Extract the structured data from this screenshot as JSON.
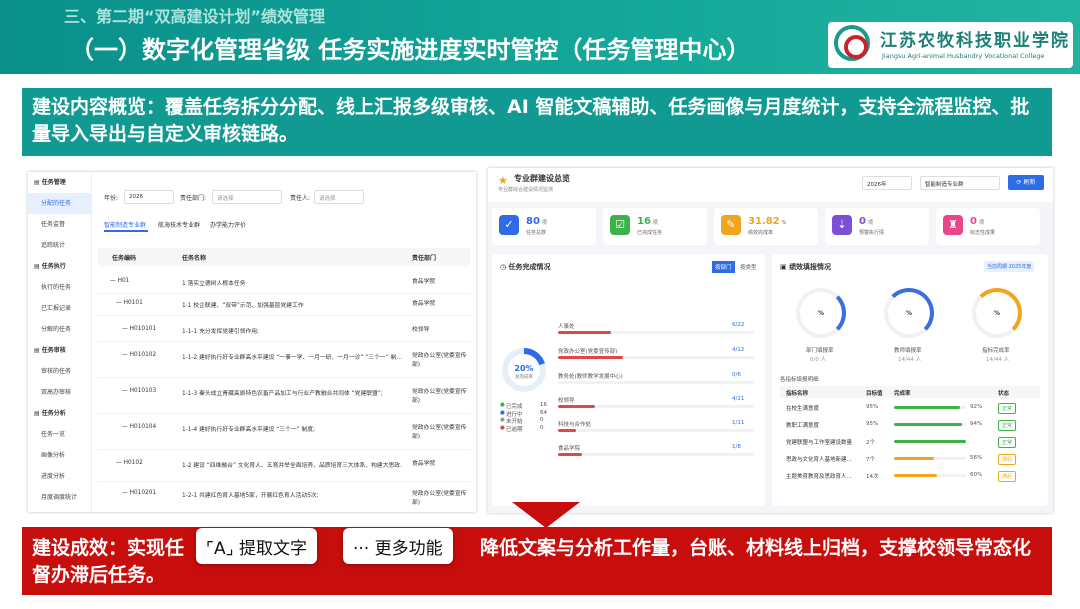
{
  "header": {
    "section": "三、第二期“双高建设计划”绩效管理",
    "title": "（一）数字化管理省级 任务实施进度实时管控（任务管理中心）",
    "school_cn": "江苏农牧科技职业学院",
    "school_en": "Jiangsu Agri-animal Husbandry Vocational College"
  },
  "overview": {
    "label": "建设内容概览：",
    "text": "覆盖任务拆分分配、线上汇报多级审核、AI 智能文稿辅助、任务画像与月度统计，支持全流程监控、批量导入导出与自定义审核链路。"
  },
  "outcome": {
    "label": "建设成效：",
    "text_a": "实现任",
    "text_b": "降低文案与分析工作量，台账、材料线上归档，支撑校领导常态化督办滞后任务。"
  },
  "popup": {
    "extract": "提取文字",
    "more": "更多功能"
  },
  "left": {
    "sidebar": [
      {
        "g": "任务管理",
        "items": [
          "分配的任务",
          "任务监督",
          "追踪统计"
        ]
      },
      {
        "g": "任务执行",
        "items": [
          "执行的任务",
          "已汇报记录",
          "分解的任务"
        ]
      },
      {
        "g": "任务审核",
        "items": [
          "审核的任务",
          "双高办审核"
        ]
      },
      {
        "g": "任务分析",
        "items": [
          "任务一览",
          "画像分析",
          "进度分析",
          "月度调度统计"
        ]
      }
    ],
    "filters": {
      "year_label": "年份:",
      "year": "2026",
      "dept_label": "责任部门:",
      "dept_ph": "请选择",
      "person_label": "责任人:",
      "person_ph": "请选择"
    },
    "tabs": [
      "智能制造专业群",
      "航海技术专业群",
      "办学能力评价"
    ],
    "cols": [
      "任务编码",
      "任务名称",
      "责任部门"
    ],
    "rows": [
      {
        "code": "— H01",
        "name": "1 落实立德树人根本任务",
        "dept": "食品学院",
        "lvl": 0
      },
      {
        "code": "— H0101",
        "name": "1-1 校企联建、“双带”示范、加强基层党建工作",
        "dept": "食品学院",
        "lvl": 1
      },
      {
        "code": "— H010101",
        "name": "1-1-1 充分发挥党建引领作用;",
        "dept": "校领导",
        "lvl": 2
      },
      {
        "code": "— H010102",
        "name": "1-1-2 建好执行好专业群高水平建设 “一事一学、一月一研、一月一诊” “三个一” 制…",
        "dept": "党政办公室(党委宣传部)",
        "lvl": 2
      },
      {
        "code": "— H010103",
        "name": "1-1-3 秦头成立青藏高原特色农畜产品加工与行业产教融合共同体 “党建联盟”;",
        "dept": "党政办公室(党委宣传部)",
        "lvl": 2
      },
      {
        "code": "— H010104",
        "name": "1-1-4 建好执行好专业群高水平建设 “三个一” 制度;",
        "dept": "党政办公室(党委宣传部)",
        "lvl": 2
      },
      {
        "code": "— H0102",
        "name": "1-2 建设 “四维融合” 文化育人、五育并举全面培养、品质培育三大体系、构建大思政…",
        "dept": "食品学院",
        "lvl": 1
      },
      {
        "code": "— H010201",
        "name": "1-2-1 共建红色育人基地5家，开展红色育人活动5次;",
        "dept": "党政办公室(党委宣传部)",
        "lvl": 2
      }
    ]
  },
  "right": {
    "title": "专业群建设总览",
    "subtitle": "专业群综合建设情况监测",
    "year": "2026年",
    "group": "智能制造专业群",
    "refresh": "刷新",
    "cards": [
      {
        "v": "80",
        "u": "项",
        "l": "任务总数",
        "c": "#2e6be6"
      },
      {
        "v": "16",
        "u": "项",
        "l": "已完成任务",
        "c": "#3cb34a"
      },
      {
        "v": "31.82",
        "u": "%",
        "l": "绩效完成率",
        "c": "#f2a51c"
      },
      {
        "v": "0",
        "u": "项",
        "l": "预警执行情",
        "c": "#7b4fd6"
      },
      {
        "v": "0",
        "u": "项",
        "l": "标志性成果",
        "c": "#e8488a"
      }
    ],
    "task": {
      "title": "任务完成情况",
      "btn_a": "按部门",
      "btn_b": "按类型",
      "pct": "20%",
      "pct_label": "总完成率",
      "legend": [
        {
          "l": "已完成",
          "v": "16",
          "c": "#3cb34a"
        },
        {
          "l": "进行中",
          "v": "64",
          "c": "#2e6be6"
        },
        {
          "l": "未开始",
          "v": "0",
          "c": "#999"
        },
        {
          "l": "已逾期",
          "v": "0",
          "c": "#e04848"
        }
      ],
      "depts": [
        {
          "n": "人事处",
          "v": "6/22",
          "p": 0.27
        },
        {
          "n": "党政办公室(党委宣传部)",
          "v": "4/12",
          "p": 0.33
        },
        {
          "n": "教务处(教师教学发展中心)",
          "v": "0/6",
          "p": 0.0
        },
        {
          "n": "校领导",
          "v": "4/21",
          "p": 0.19
        },
        {
          "n": "科技与合作处",
          "v": "1/11",
          "p": 0.09
        },
        {
          "n": "食品学院",
          "v": "1/8",
          "p": 0.12
        }
      ]
    },
    "perf": {
      "title": "绩效填报情况",
      "tag_a": "当前周期",
      "tag_b": "2025年度",
      "gauges": [
        {
          "pct": "%",
          "n": "部门填报率",
          "s": "0/0 人",
          "c": "#3b6fe0"
        },
        {
          "pct": "%",
          "n": "教师填报率",
          "s": "14/44 人",
          "c": "#3b6fe0"
        },
        {
          "pct": "%",
          "n": "指标完成率",
          "s": "14/44 人",
          "c": "#f2a51c"
        }
      ],
      "sub": "各指标填报明细",
      "cols": [
        "指标名称",
        "目标值",
        "完成率",
        "状态"
      ],
      "rows": [
        {
          "n": "在校生满意度",
          "t": "95%",
          "r": "92%",
          "p": 0.92,
          "s": "正常",
          "c": "#3cb34a"
        },
        {
          "n": "教职工满意度",
          "t": "95%",
          "r": "94%",
          "p": 0.94,
          "s": "正常",
          "c": "#3cb34a"
        },
        {
          "n": "党建联盟与工作室建设数量",
          "t": "2个",
          "r": "",
          "p": 1.0,
          "s": "正常",
          "c": "#3cb34a"
        },
        {
          "n": "思政与文化育人基地新建…",
          "t": "7个",
          "r": "56%",
          "p": 0.56,
          "s": "滞后",
          "c": "#f2a51c"
        },
        {
          "n": "主题美育教育及思政育人…",
          "t": "14次",
          "r": "60%",
          "p": 0.6,
          "s": "滞后",
          "c": "#f2a51c"
        }
      ]
    }
  }
}
